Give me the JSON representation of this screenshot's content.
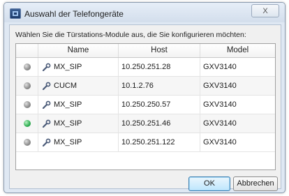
{
  "window": {
    "title": "Auswahl der Telefongeräte",
    "close_label": "X"
  },
  "instruction": "Wählen Sie die Türstations-Module aus, die Sie konfigurieren möchten:",
  "table": {
    "columns": [
      "",
      "Name",
      "Host",
      "Model"
    ],
    "rows": [
      {
        "status": "grey",
        "name": "MX_SIP",
        "host": "10.250.251.28",
        "model": "GXV3140"
      },
      {
        "status": "grey",
        "name": "CUCM",
        "host": "10.1.2.76",
        "model": "GXV3140"
      },
      {
        "status": "grey",
        "name": "MX_SIP",
        "host": "10.250.250.57",
        "model": "GXV3140"
      },
      {
        "status": "green",
        "name": "MX_SIP",
        "host": "10.250.251.46",
        "model": "GXV3140"
      },
      {
        "status": "grey",
        "name": "MX_SIP",
        "host": "10.250.251.122",
        "model": "GXV3140"
      }
    ]
  },
  "buttons": {
    "ok": "OK",
    "cancel": "Abbrechen"
  },
  "icons": {
    "row_device_icon": "wrench-icon",
    "status_icon": "status-led-icon",
    "app_icon": "app-icon"
  },
  "colors": {
    "status_green": "#2fae52",
    "status_grey": "#8c8c8c"
  }
}
